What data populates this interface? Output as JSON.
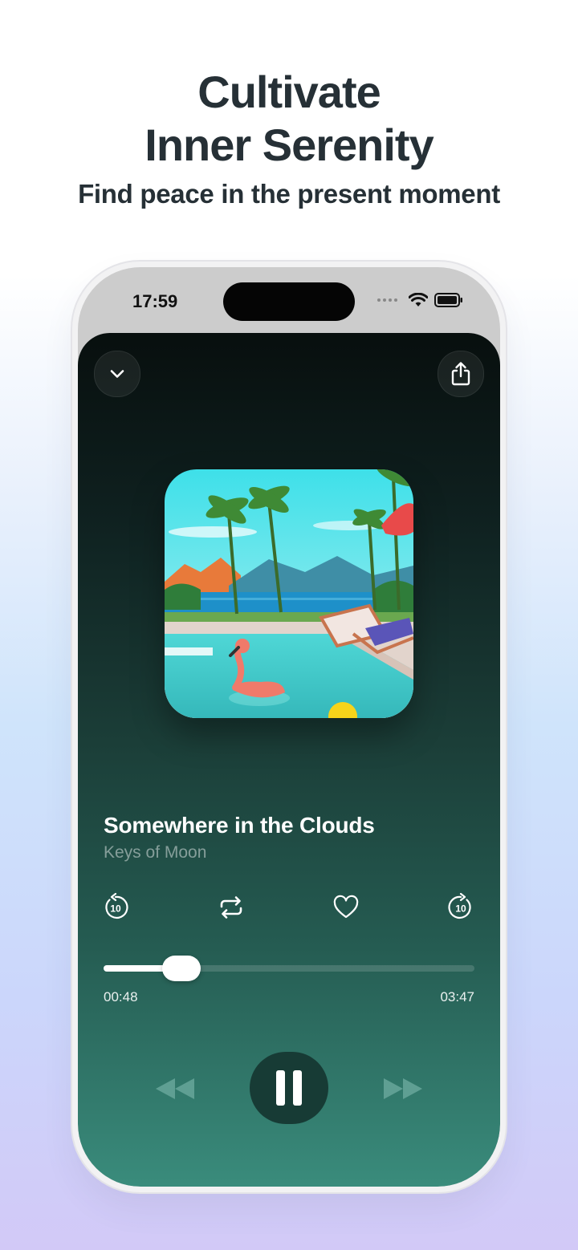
{
  "promo": {
    "headline_line1": "Cultivate",
    "headline_line2": "Inner Serenity",
    "subheadline": "Find peace in the present moment"
  },
  "status_bar": {
    "time": "17:59"
  },
  "player": {
    "track_title": "Somewhere in the Clouds",
    "artist": "Keys of Moon",
    "elapsed": "00:48",
    "duration": "03:47",
    "progress": 0.211,
    "skip_back_seconds": "10",
    "skip_forward_seconds": "10",
    "state": "playing"
  },
  "icons": {
    "collapse": "chevron-down-icon",
    "share": "share-icon",
    "skip_back": "rewind-10-icon",
    "repeat": "repeat-icon",
    "favorite": "heart-icon",
    "skip_forward": "forward-10-icon",
    "previous": "previous-track-icon",
    "pause": "pause-icon",
    "next": "next-track-icon"
  },
  "colors": {
    "headline_text": "#263036",
    "screen_top": "#080f0e",
    "screen_bottom": "#3a8c7c",
    "play_button": "#173b35",
    "progress_fill": "#ffffff"
  }
}
